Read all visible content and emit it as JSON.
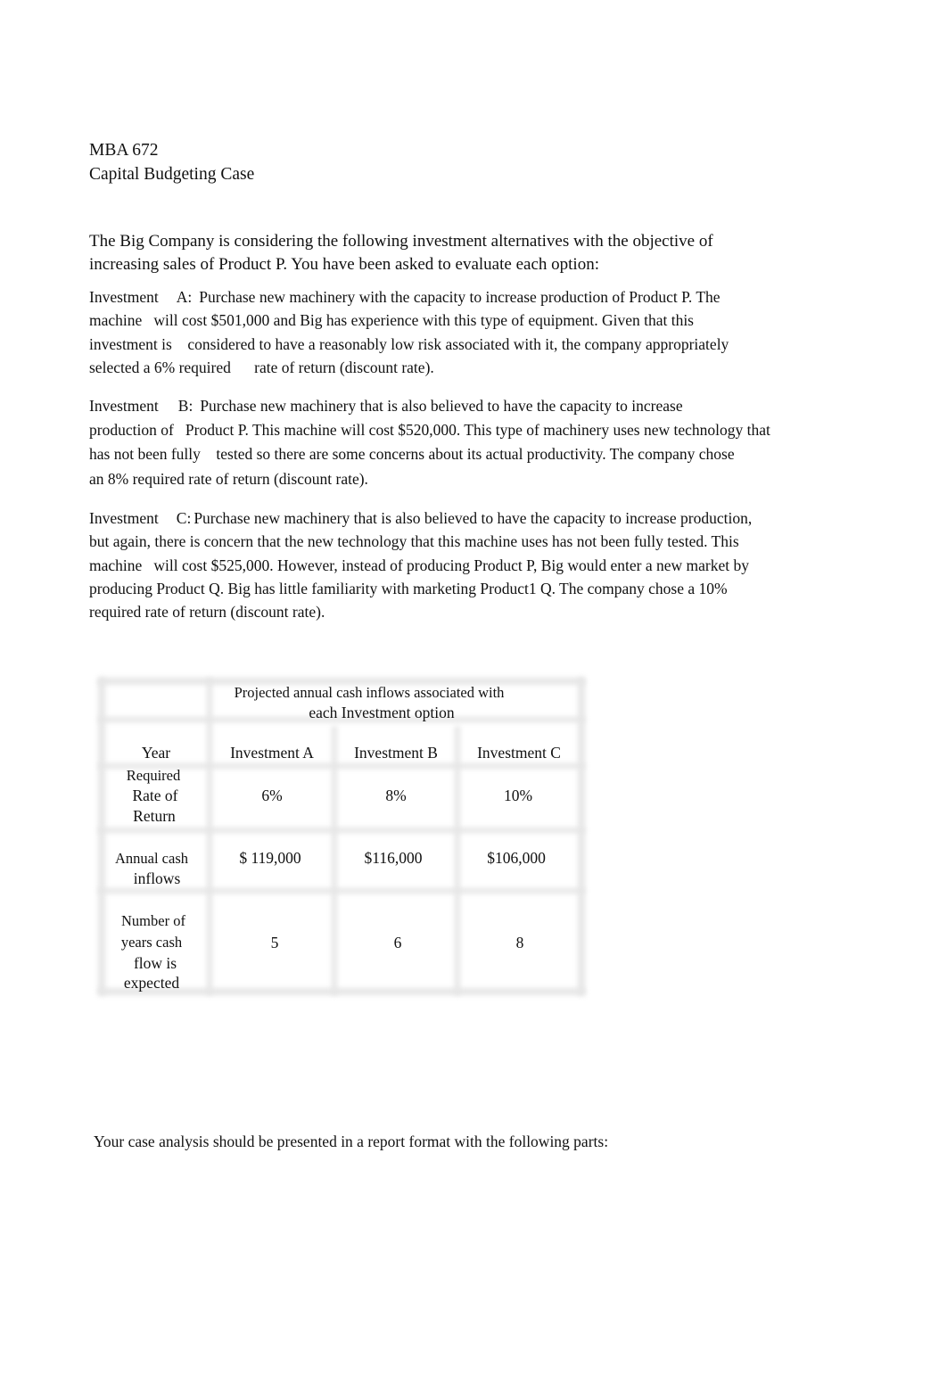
{
  "document": {
    "course": "MBA 672",
    "title": "Capital Budgeting Case",
    "intro_lines": [
      "The Big Company is considering the following investment alternatives with the objective of",
      "increasing   sales of Product P. You have been asked to evaluate each option:"
    ],
    "investments": [
      {
        "label": "Investment",
        "letter": "A:",
        "lines": [
          "Purchase new machinery with the capacity to increase production of Product P. The",
          "machine   will cost $501,000 and Big has experience with this type of equipment. Given that this",
          "investment is    considered to have a reasonably low risk associated with it, the company appropriately",
          "selected a 6% required      rate of return (discount rate)."
        ]
      },
      {
        "label": "Investment",
        "letter": "B:",
        "lines": [
          "Purchase new machinery that is also believed to have the capacity to increase",
          "production of   Product P. This machine will cost $520,000. This type of machinery uses new technology that",
          "has not been fully    tested so there are some concerns about its actual productivity. The company chose",
          "an 8% required rate of return (discount rate)."
        ]
      },
      {
        "label": "Investment",
        "letter": "C:",
        "lines": [
          "Purchase new machinery that is also believed to have the capacity to increase production,",
          "but again, there is concern that the new technology that this machine uses has not been fully tested. This",
          "machine   will cost $525,000. However, instead of producing Product P, Big would enter a new market by",
          "producing Product Q. Big has little familiarity with marketing Product1 Q. The company chose a 10%",
          "required rate of return (discount rate)."
        ]
      }
    ],
    "table": {
      "caption_lines": [
        "Projected annual cash inflows associated with",
        "each Investment option"
      ],
      "columns": [
        "Year",
        "Investment A",
        "Investment B",
        "Investment C"
      ],
      "rows": [
        {
          "label_lines": [
            "Required",
            "Rate of",
            "Return"
          ],
          "values": [
            "6%",
            "8%",
            "10%"
          ]
        },
        {
          "label_lines": [
            "Annual cash",
            "inflows"
          ],
          "values": [
            "$ 119,000",
            "$116,000",
            "$106,000"
          ]
        },
        {
          "label_lines": [
            "Number of",
            "years cash",
            "flow is",
            "expected"
          ],
          "values": [
            "5",
            "6",
            "8"
          ]
        }
      ]
    },
    "closing": "Your case analysis should be presented in a report format with the following parts:"
  }
}
